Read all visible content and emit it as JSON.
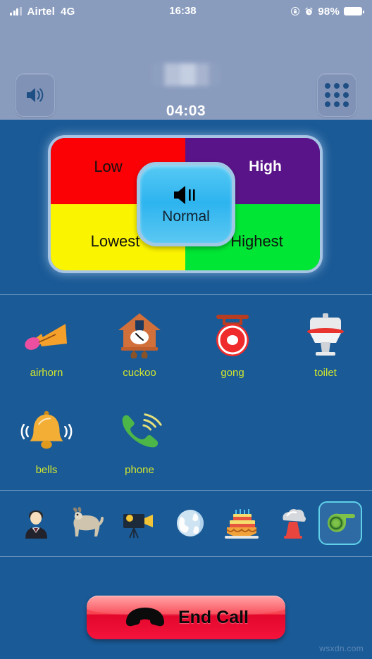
{
  "statusbar": {
    "carrier": "Airtel",
    "network": "4G",
    "time": "16:38",
    "battery_percent": "98%",
    "signal_icon": "signal-bars-icon",
    "rotation_lock_icon": "rotation-lock-icon",
    "alarm_icon": "alarm-clock-icon",
    "battery_icon": "battery-icon"
  },
  "call_header": {
    "speaker_button": "speaker-button",
    "keypad_button": "keypad-button",
    "contact_name": "",
    "call_duration": "04:03"
  },
  "pitch_selector": {
    "quadrants": [
      {
        "label": "Low",
        "color": "#fb0005"
      },
      {
        "label": "High",
        "color": "#5a1489"
      },
      {
        "label": "Lowest",
        "color": "#fbf400"
      },
      {
        "label": "Highest",
        "color": "#00e634"
      }
    ],
    "center": {
      "label": "Normal",
      "color": "#2db4ef"
    }
  },
  "sounds": {
    "rows": [
      [
        {
          "label": "airhorn",
          "icon": "airhorn-icon"
        },
        {
          "label": "cuckoo",
          "icon": "cuckoo-clock-icon"
        },
        {
          "label": "gong",
          "icon": "gong-icon"
        },
        {
          "label": "toilet",
          "icon": "toilet-icon"
        }
      ],
      [
        {
          "label": "bells",
          "icon": "bell-icon"
        },
        {
          "label": "phone",
          "icon": "phone-ringing-icon"
        }
      ]
    ]
  },
  "categories": {
    "items": [
      {
        "name": "person-icon",
        "selected": false
      },
      {
        "name": "goat-icon",
        "selected": false
      },
      {
        "name": "movie-camera-icon",
        "selected": false
      },
      {
        "name": "globe-icon",
        "selected": false
      },
      {
        "name": "birthday-cake-icon",
        "selected": false
      },
      {
        "name": "explosion-icon",
        "selected": false
      },
      {
        "name": "whistle-icon",
        "selected": true
      }
    ]
  },
  "end_call": {
    "label": "End Call",
    "icon": "phone-hangup-icon",
    "color": "#e3072c"
  },
  "watermark": "wsxdn.com",
  "theme": {
    "background": "#1a5a96",
    "header_background": "#8a9cbe",
    "label_color": "#d2e62e"
  }
}
